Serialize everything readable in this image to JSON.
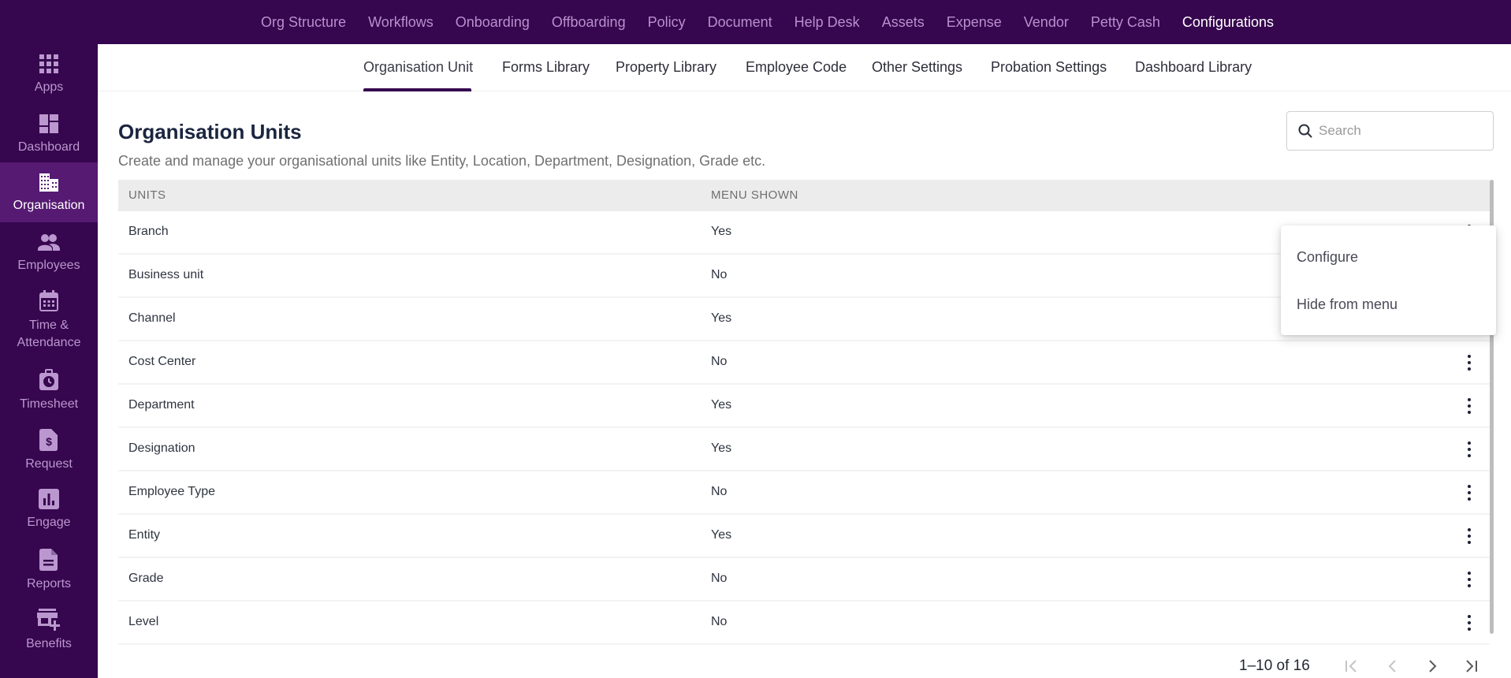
{
  "top_nav": {
    "items": [
      {
        "label": "Org Structure",
        "active": false
      },
      {
        "label": "Workflows",
        "active": false
      },
      {
        "label": "Onboarding",
        "active": false
      },
      {
        "label": "Offboarding",
        "active": false
      },
      {
        "label": "Policy",
        "active": false
      },
      {
        "label": "Document",
        "active": false
      },
      {
        "label": "Help Desk",
        "active": false
      },
      {
        "label": "Assets",
        "active": false
      },
      {
        "label": "Expense",
        "active": false
      },
      {
        "label": "Vendor",
        "active": false
      },
      {
        "label": "Petty Cash",
        "active": false
      },
      {
        "label": "Configurations",
        "active": true
      }
    ]
  },
  "sidebar": {
    "items": [
      {
        "label": "Apps",
        "icon": "apps-grid-icon"
      },
      {
        "label": "Dashboard",
        "icon": "dashboard-icon"
      },
      {
        "label": "Organisation",
        "icon": "building-icon",
        "active": true
      },
      {
        "label": "Employees",
        "icon": "people-icon"
      },
      {
        "label": "Time & Attendance",
        "icon": "calendar-icon"
      },
      {
        "label": "Timesheet",
        "icon": "timesheet-clock-icon"
      },
      {
        "label": "Request",
        "icon": "request-dollar-icon"
      },
      {
        "label": "Engage",
        "icon": "bar-chart-icon"
      },
      {
        "label": "Reports",
        "icon": "document-icon"
      },
      {
        "label": "Benefits",
        "icon": "store-plus-icon"
      }
    ]
  },
  "sub_tabs": {
    "items": [
      {
        "label": "Organisation Unit",
        "active": true
      },
      {
        "label": "Forms Library"
      },
      {
        "label": "Property Library"
      },
      {
        "label": "Employee Code"
      },
      {
        "label": "Other Settings"
      },
      {
        "label": "Probation Settings"
      },
      {
        "label": "Dashboard Library"
      }
    ]
  },
  "page": {
    "title": "Organisation Units",
    "subtitle": "Create and manage your organisational units like Entity, Location, Department, Designation, Grade etc."
  },
  "search": {
    "placeholder": "Search",
    "value": ""
  },
  "table": {
    "columns": [
      "UNITS",
      "MENU SHOWN"
    ],
    "rows": [
      {
        "unit": "Branch",
        "menu_shown": "Yes"
      },
      {
        "unit": "Business unit",
        "menu_shown": "No"
      },
      {
        "unit": "Channel",
        "menu_shown": "Yes"
      },
      {
        "unit": "Cost Center",
        "menu_shown": "No"
      },
      {
        "unit": "Department",
        "menu_shown": "Yes"
      },
      {
        "unit": "Designation",
        "menu_shown": "Yes"
      },
      {
        "unit": "Employee Type",
        "menu_shown": "No"
      },
      {
        "unit": "Entity",
        "menu_shown": "Yes"
      },
      {
        "unit": "Grade",
        "menu_shown": "No"
      },
      {
        "unit": "Level",
        "menu_shown": "No"
      }
    ]
  },
  "context_menu": {
    "items": [
      "Configure",
      "Hide from menu"
    ]
  },
  "pagination": {
    "range_label": "1–10 of 16",
    "first_enabled": false,
    "prev_enabled": false,
    "next_enabled": true,
    "last_enabled": true
  },
  "colors": {
    "brand_purple": "#36064e",
    "active_sidebar": "#561a72"
  }
}
